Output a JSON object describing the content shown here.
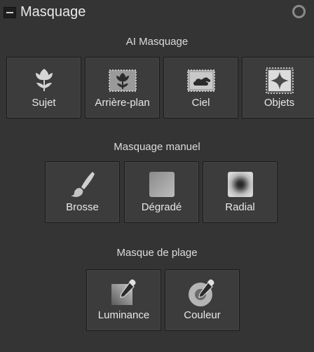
{
  "panel": {
    "title": "Masquage"
  },
  "ai_section": {
    "title": "AI Masquage",
    "buttons": [
      {
        "label": "Sujet",
        "icon": "tulip-icon"
      },
      {
        "label": "Arrière-plan",
        "icon": "background-tulip-icon"
      },
      {
        "label": "Ciel",
        "icon": "sky-cloud-icon"
      },
      {
        "label": "Objets",
        "icon": "sparkle-object-icon"
      }
    ]
  },
  "manual_section": {
    "title": "Masquage manuel",
    "buttons": [
      {
        "label": "Brosse",
        "icon": "brush-icon"
      },
      {
        "label": "Dégradé",
        "icon": "gradient-icon"
      },
      {
        "label": "Radial",
        "icon": "radial-icon"
      }
    ]
  },
  "range_section": {
    "title": "Masque de plage",
    "buttons": [
      {
        "label": "Luminance",
        "icon": "luminance-eyedropper-icon"
      },
      {
        "label": "Couleur",
        "icon": "color-eyedropper-icon"
      }
    ]
  }
}
